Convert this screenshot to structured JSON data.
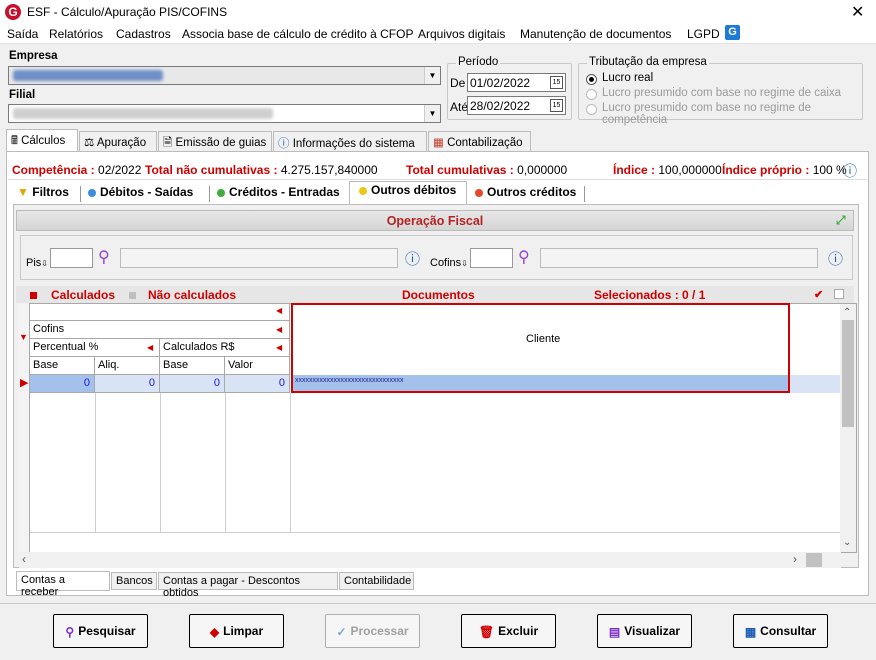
{
  "window": {
    "title": "ESF - Cálculo/Apuração PIS/COFINS",
    "close": "✕"
  },
  "menu": {
    "items": [
      "Saída",
      "Relatórios",
      "Cadastros",
      "Associa base de cálculo de crédito à CFOP",
      "Arquivos digitais",
      "Manutenção de documentos",
      "LGPD"
    ]
  },
  "empresa": {
    "label": "Empresa"
  },
  "filial": {
    "label": "Filial"
  },
  "periodo": {
    "title": "Período",
    "de_label": "De",
    "de_value": "01/02/2022",
    "ate_label": "Até",
    "ate_value": "28/02/2022"
  },
  "tributacao": {
    "title": "Tributação da empresa",
    "options": [
      "Lucro real",
      "Lucro presumido com base no regime de caixa",
      "Lucro presumido com base no regime de competência"
    ],
    "selected": 0
  },
  "main_tabs": [
    "Cálculos",
    "Apuração",
    "Emissão de guias",
    "Informações do sistema",
    "Contabilização"
  ],
  "summary": {
    "competencia_label": "Competência :",
    "competencia_value": "02/2022",
    "total_nao_label": "Total não cumulativas :",
    "total_nao_value": "4.275.157,840000",
    "total_cum_label": "Total cumulativas :",
    "total_cum_value": "0,000000",
    "indice_label": "Índice :",
    "indice_value": "100,000000",
    "indice_proprio_label": "Índice próprio :",
    "indice_proprio_value": "100 %"
  },
  "sub_tabs": [
    "Filtros",
    "Débitos - Saídas",
    "Créditos - Entradas",
    "Outros débitos",
    "Outros créditos"
  ],
  "operacao": {
    "title": "Operação Fiscal",
    "pis_label": "Pis",
    "cofins_label": "Cofins"
  },
  "table": {
    "calculados": "Calculados",
    "nao_calculados": "Não calculados",
    "documentos": "Documentos",
    "selecionados": "Selecionados : 0 / 1",
    "cofins": "Cofins",
    "percentual": "Percentual %",
    "calculados_rs": "Calculados R$",
    "cols": [
      "Base",
      "Aliq.",
      "Base",
      "Valor"
    ],
    "cliente": "Cliente",
    "row": [
      "0",
      "0",
      "0",
      "0"
    ],
    "cliente_value": "xxxxxxxxxxxxxxxxxxxxxxxxxxxxxxx"
  },
  "bottom_tabs": [
    "Contas a receber",
    "Bancos",
    "Contas a pagar - Descontos obtidos",
    "Contabilidade"
  ],
  "buttons": {
    "pesquisar": "Pesquisar",
    "limpar": "Limpar",
    "processar": "Processar",
    "excluir": "Excluir",
    "visualizar": "Visualizar",
    "consultar": "Consultar"
  }
}
